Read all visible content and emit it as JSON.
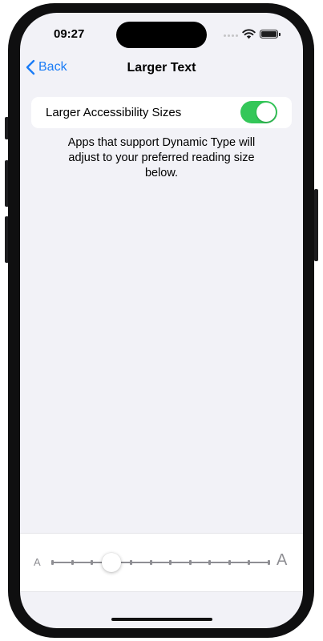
{
  "status_bar": {
    "time": "09:27",
    "icons": [
      "cellular-signal-icon",
      "wifi-icon",
      "battery-icon"
    ]
  },
  "nav": {
    "back_label": "Back",
    "title": "Larger Text"
  },
  "setting": {
    "label": "Larger Accessibility Sizes",
    "toggle_on": true
  },
  "footer_text": "Apps that support Dynamic Type will adjust to your preferred reading size below.",
  "slider": {
    "small_label": "A",
    "large_label": "A",
    "steps": 12,
    "selected_index": 3
  },
  "colors": {
    "accent": "#1a7cf6",
    "toggle_on": "#34c759",
    "background": "#f2f2f7"
  }
}
